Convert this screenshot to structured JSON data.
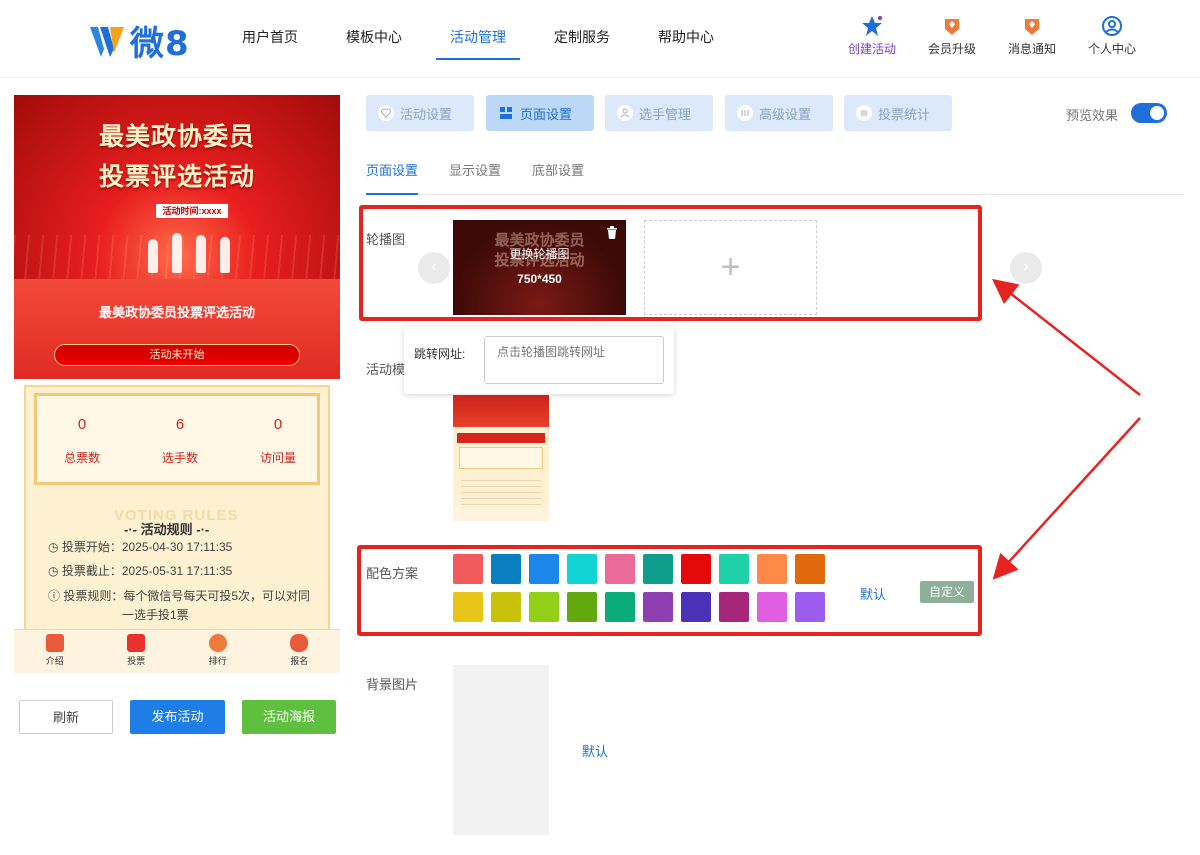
{
  "logo": {
    "text": "微8"
  },
  "nav": {
    "links": [
      "用户首页",
      "模板中心",
      "活动管理",
      "定制服务",
      "帮助中心"
    ],
    "right": [
      "创建活动",
      "会员升级",
      "消息通知",
      "个人中心"
    ]
  },
  "phone": {
    "banner_line1": "最美政协委员",
    "banner_line2": "投票评选活动",
    "banner_time": "活动时间:xxxx",
    "activity_name": "最美政协委员投票评选活动",
    "status": "活动未开始",
    "stats": [
      {
        "value": "0",
        "label": "总票数"
      },
      {
        "value": "6",
        "label": "选手数"
      },
      {
        "value": "0",
        "label": "访问量"
      }
    ],
    "rules_watermark": "VOTING RULES",
    "rules_title": "活动规则",
    "rules": [
      "投票开始：2025-04-30 17:11:35",
      "投票截止：2025-05-31 17:11:35",
      "投票规则：每个微信号每天可投5次，可以对同",
      "一选手投1票"
    ],
    "tabbar": [
      "介绍",
      "投票",
      "排行",
      "报名"
    ]
  },
  "buttons": {
    "refresh": "刷新",
    "publish": "发布活动",
    "poster": "活动海报"
  },
  "steps": [
    "活动设置",
    "页面设置",
    "选手管理",
    "高级设置",
    "投票统计"
  ],
  "preview_label": "预览效果",
  "subtabs": [
    "页面设置",
    "显示设置",
    "底部设置"
  ],
  "carousel": {
    "label": "轮播图",
    "slide_title1": "最美政协委员",
    "slide_title2": "投票评选活动",
    "replace_text": "更换轮播图",
    "size_text": "750*450",
    "add_symbol": "+"
  },
  "popover": {
    "label": "跳转网址:",
    "placeholder": "点击轮播图跳转网址"
  },
  "template": {
    "label": "活动模"
  },
  "color_scheme": {
    "label": "配色方案",
    "row1": [
      "#f25b5b",
      "#0a7fbf",
      "#1b87e8",
      "#11d4d4",
      "#ea6a9a",
      "#0f9d8c",
      "#e40a0a",
      "#1fd1a8",
      "#ff8a47",
      "#e06a0b"
    ],
    "row2": [
      "#e9c419",
      "#c9c20a",
      "#92d018",
      "#62a80f",
      "#0aad7a",
      "#8e3fb2",
      "#4a32b8",
      "#a6267a",
      "#e05fe0",
      "#9d5cf0"
    ],
    "default": "默认",
    "custom": "自定义"
  },
  "background": {
    "label": "背景图片",
    "default": "默认"
  }
}
